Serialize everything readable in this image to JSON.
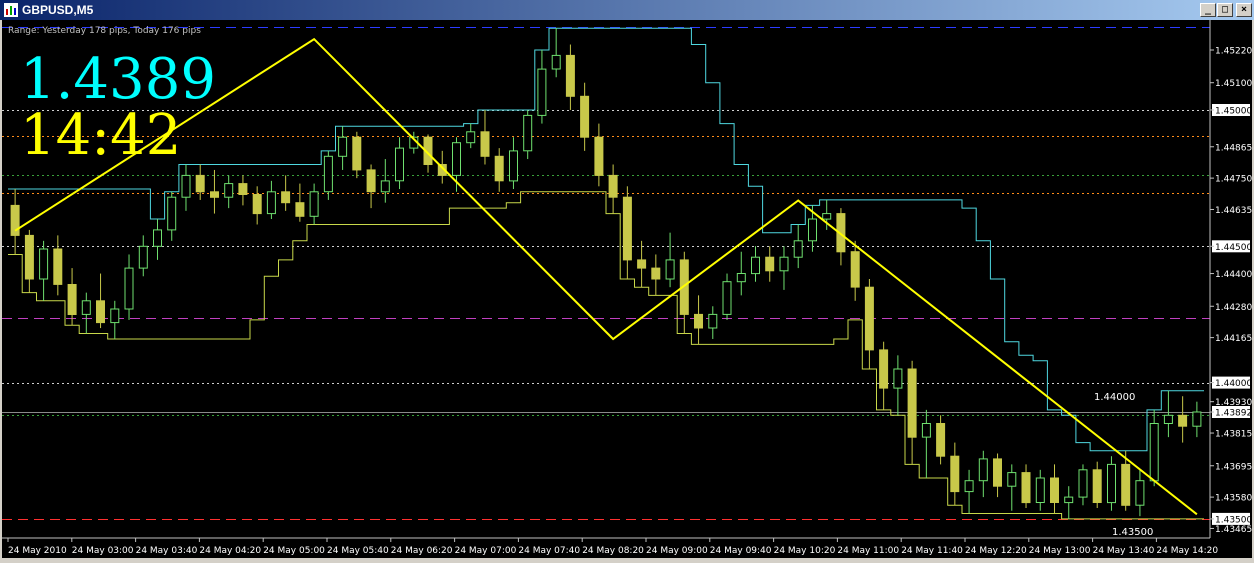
{
  "window": {
    "title": "GBPUSD,M5",
    "min_glyph": "_",
    "max_glyph": "□",
    "close_glyph": "×"
  },
  "overlay": {
    "range_text": "Range: Yesterday 178 pips, Today 176 pips",
    "big_price": "1.4389",
    "big_time": "14:42",
    "price_color": "#00ffff",
    "time_color": "#ffff00"
  },
  "annotations": {
    "level_label_1": "1.44000",
    "level_label_2": "1.43500"
  },
  "chart_data": {
    "type": "candlestick",
    "symbol": "GBPUSD",
    "timeframe": "M5",
    "ylim": [
      1.4343,
      1.4533
    ],
    "y_ticks": [
      "1.45220",
      "1.45100",
      "1.45000",
      "1.44865",
      "1.44750",
      "1.44635",
      "1.44500",
      "1.44400",
      "1.44280",
      "1.44165",
      "1.44000",
      "1.43930",
      "1.43892",
      "1.43815",
      "1.43695",
      "1.43580",
      "1.43500",
      "1.43465"
    ],
    "highlighted_ticks": [
      "1.45000",
      "1.44500",
      "1.44000",
      "1.43892",
      "1.43500"
    ],
    "x_ticks": [
      "24 May 2010",
      "24 May 03:00",
      "24 May 03:40",
      "24 May 04:20",
      "24 May 05:00",
      "24 May 05:40",
      "24 May 06:20",
      "24 May 07:00",
      "24 May 07:40",
      "24 May 08:20",
      "24 May 09:00",
      "24 May 09:40",
      "24 May 10:20",
      "24 May 11:00",
      "24 May 11:40",
      "24 May 12:20",
      "24 May 13:00",
      "24 May 13:40",
      "24 May 14:20"
    ],
    "current_price": 1.43892,
    "horizontal_levels": [
      {
        "price": 1.45304,
        "color": "#2c3cff",
        "style": "dashed"
      },
      {
        "price": 1.45,
        "color": "#cfcfcf",
        "style": "dotted"
      },
      {
        "price": 1.44904,
        "color": "#ff8c1a",
        "style": "dotted"
      },
      {
        "price": 1.4476,
        "color": "#3aa03a",
        "style": "dotted"
      },
      {
        "price": 1.44695,
        "color": "#ff8c1a",
        "style": "dotted"
      },
      {
        "price": 1.445,
        "color": "#cfcfcf",
        "style": "dotted"
      },
      {
        "price": 1.44236,
        "color": "#c040c0",
        "style": "dashed"
      },
      {
        "price": 1.44,
        "color": "#cfcfcf",
        "style": "dotted"
      },
      {
        "price": 1.43892,
        "color": "#8a8a8a",
        "style": "solid"
      },
      {
        "price": 1.4388,
        "color": "#3aa03a",
        "style": "dotted"
      },
      {
        "price": 1.435,
        "color": "#ff3030",
        "style": "dashed"
      }
    ],
    "zigzag": [
      [
        0,
        1.44557
      ],
      [
        3,
        1.4526
      ],
      [
        6,
        1.4416
      ],
      [
        8,
        1.44668
      ],
      [
        12,
        1.43517
      ]
    ],
    "candles": [
      [
        1.4465,
        1.4471,
        1.4447,
        1.4454
      ],
      [
        1.4454,
        1.4456,
        1.4433,
        1.4438
      ],
      [
        1.4438,
        1.4452,
        1.443,
        1.4449
      ],
      [
        1.4449,
        1.4454,
        1.4432,
        1.4436
      ],
      [
        1.4436,
        1.4442,
        1.4421,
        1.4425
      ],
      [
        1.4425,
        1.4433,
        1.4418,
        1.443
      ],
      [
        1.443,
        1.444,
        1.442,
        1.4422
      ],
      [
        1.4422,
        1.443,
        1.4416,
        1.4427
      ],
      [
        1.4427,
        1.4447,
        1.4423,
        1.4442
      ],
      [
        1.4442,
        1.4454,
        1.4439,
        1.445
      ],
      [
        1.445,
        1.446,
        1.4445,
        1.4456
      ],
      [
        1.4456,
        1.447,
        1.4452,
        1.4468
      ],
      [
        1.4468,
        1.448,
        1.4463,
        1.4476
      ],
      [
        1.4476,
        1.448,
        1.4467,
        1.447
      ],
      [
        1.447,
        1.4478,
        1.4462,
        1.4468
      ],
      [
        1.4468,
        1.4476,
        1.4464,
        1.4473
      ],
      [
        1.4473,
        1.4476,
        1.4465,
        1.4469
      ],
      [
        1.4469,
        1.4472,
        1.4458,
        1.4462
      ],
      [
        1.4462,
        1.4474,
        1.446,
        1.447
      ],
      [
        1.447,
        1.4476,
        1.4463,
        1.4466
      ],
      [
        1.4466,
        1.4473,
        1.4459,
        1.4461
      ],
      [
        1.4461,
        1.4473,
        1.4458,
        1.447
      ],
      [
        1.447,
        1.4485,
        1.4467,
        1.4483
      ],
      [
        1.4483,
        1.4494,
        1.4478,
        1.449
      ],
      [
        1.449,
        1.4492,
        1.4475,
        1.4478
      ],
      [
        1.4478,
        1.448,
        1.4464,
        1.447
      ],
      [
        1.447,
        1.4482,
        1.4466,
        1.4474
      ],
      [
        1.4474,
        1.449,
        1.4471,
        1.4486
      ],
      [
        1.4486,
        1.4492,
        1.4484,
        1.449
      ],
      [
        1.449,
        1.4491,
        1.4477,
        1.448
      ],
      [
        1.448,
        1.4485,
        1.4473,
        1.4476
      ],
      [
        1.4476,
        1.449,
        1.447,
        1.4488
      ],
      [
        1.4488,
        1.4495,
        1.4486,
        1.4492
      ],
      [
        1.4492,
        1.45,
        1.448,
        1.4483
      ],
      [
        1.4483,
        1.4486,
        1.447,
        1.4474
      ],
      [
        1.4474,
        1.449,
        1.4471,
        1.4485
      ],
      [
        1.4485,
        1.45,
        1.4482,
        1.4498
      ],
      [
        1.4498,
        1.4522,
        1.4495,
        1.4515
      ],
      [
        1.4515,
        1.453,
        1.4512,
        1.452
      ],
      [
        1.452,
        1.4524,
        1.45,
        1.4505
      ],
      [
        1.4505,
        1.451,
        1.4485,
        1.449
      ],
      [
        1.449,
        1.4495,
        1.4472,
        1.4476
      ],
      [
        1.4476,
        1.448,
        1.4462,
        1.4468
      ],
      [
        1.4468,
        1.4472,
        1.4438,
        1.4445
      ],
      [
        1.4445,
        1.4452,
        1.4435,
        1.4442
      ],
      [
        1.4442,
        1.4447,
        1.4432,
        1.4438
      ],
      [
        1.4438,
        1.4455,
        1.4435,
        1.4445
      ],
      [
        1.4445,
        1.4448,
        1.4418,
        1.4425
      ],
      [
        1.4425,
        1.4432,
        1.4414,
        1.442
      ],
      [
        1.442,
        1.4428,
        1.4416,
        1.4425
      ],
      [
        1.4425,
        1.444,
        1.4423,
        1.4437
      ],
      [
        1.4437,
        1.4448,
        1.4432,
        1.444
      ],
      [
        1.444,
        1.445,
        1.4437,
        1.4446
      ],
      [
        1.4446,
        1.445,
        1.4437,
        1.4441
      ],
      [
        1.4441,
        1.445,
        1.4434,
        1.4446
      ],
      [
        1.4446,
        1.4458,
        1.4442,
        1.4452
      ],
      [
        1.4452,
        1.4465,
        1.4448,
        1.446
      ],
      [
        1.446,
        1.4467,
        1.4456,
        1.4462
      ],
      [
        1.4462,
        1.4464,
        1.4443,
        1.4448
      ],
      [
        1.4448,
        1.4452,
        1.443,
        1.4435
      ],
      [
        1.4435,
        1.4438,
        1.4405,
        1.4412
      ],
      [
        1.4412,
        1.4415,
        1.439,
        1.4398
      ],
      [
        1.4398,
        1.441,
        1.4388,
        1.4405
      ],
      [
        1.4405,
        1.4408,
        1.437,
        1.438
      ],
      [
        1.438,
        1.439,
        1.4365,
        1.4385
      ],
      [
        1.4385,
        1.4388,
        1.437,
        1.4373
      ],
      [
        1.4373,
        1.4378,
        1.4355,
        1.436
      ],
      [
        1.436,
        1.4368,
        1.4352,
        1.4364
      ],
      [
        1.4364,
        1.4375,
        1.4358,
        1.4372
      ],
      [
        1.4372,
        1.4374,
        1.4358,
        1.4362
      ],
      [
        1.4362,
        1.437,
        1.4353,
        1.4367
      ],
      [
        1.4367,
        1.437,
        1.4354,
        1.4356
      ],
      [
        1.4356,
        1.4368,
        1.4353,
        1.4365
      ],
      [
        1.4365,
        1.437,
        1.4352,
        1.4356
      ],
      [
        1.4356,
        1.4362,
        1.435,
        1.4358
      ],
      [
        1.4358,
        1.437,
        1.4355,
        1.4368
      ],
      [
        1.4368,
        1.4371,
        1.4354,
        1.4356
      ],
      [
        1.4356,
        1.4373,
        1.4353,
        1.437
      ],
      [
        1.437,
        1.4375,
        1.4353,
        1.4355
      ],
      [
        1.4355,
        1.4368,
        1.4351,
        1.4364
      ],
      [
        1.4364,
        1.439,
        1.4362,
        1.4385
      ],
      [
        1.4385,
        1.4397,
        1.438,
        1.4388
      ],
      [
        1.4388,
        1.4395,
        1.4378,
        1.4384
      ],
      [
        1.4384,
        1.4393,
        1.438,
        1.43892
      ]
    ]
  }
}
